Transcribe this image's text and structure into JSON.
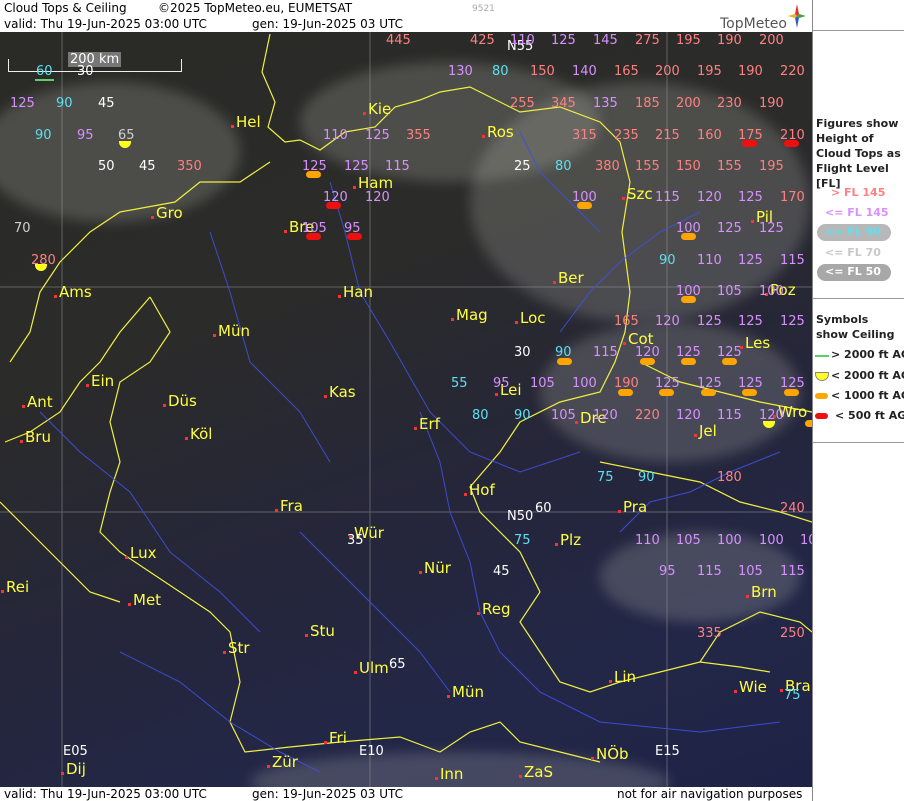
{
  "header": {
    "title": "Cloud Tops & Ceiling",
    "copyright": "©2025 TopMeteo.eu, EUMETSAT",
    "valid": "valid:  Thu  19-Jun-2025  03:00 UTC",
    "gen": "gen: 19-Jun-2025 03 UTC",
    "code": "9521",
    "logo": "TopMeteo",
    "logo_icon": "compass-star-icon"
  },
  "footer": {
    "valid": "valid:  Thu  19-Jun-2025  03:00 UTC",
    "gen": "gen: 19-Jun-2025 03 UTC",
    "disclaimer": "not for air navigation purposes"
  },
  "scale": {
    "label": "200 km"
  },
  "grid_labels": [
    "N55",
    "N50",
    "E05",
    "E10",
    "E15"
  ],
  "cities": [
    "Kie",
    "Hel",
    "Ros",
    "Ham",
    "Gro",
    "Bre",
    "Ber",
    "Szc",
    "Pil",
    "Ams",
    "Han",
    "Mag",
    "Loc",
    "Poz",
    "Mün",
    "Cot",
    "Les",
    "Ein",
    "Ant",
    "Düs",
    "Kas",
    "Lei",
    "Köl",
    "Erf",
    "Dre",
    "Bru",
    "Wro",
    "Jel",
    "Hof",
    "Fra",
    "Pra",
    "Würz",
    "Lux",
    "Plz",
    "Nür",
    "Rei",
    "Met",
    "Reg",
    "Brn",
    "Stu",
    "Str",
    "Ulm",
    "Lin",
    "Mün",
    "Wie",
    "Bra",
    "Fri",
    "Zür",
    "Inn",
    "ZaS",
    "NÖb",
    "Dij"
  ],
  "city_labels": {
    "c0": "Kie",
    "c1": "Hel",
    "c2": "Ros",
    "c3": "Ham",
    "c4": "Gro",
    "c5": "Bre",
    "c6": "Ber",
    "c7": "Szc",
    "c8": "Pil",
    "c9": "Ams",
    "c10": "Han",
    "c11": "Mag",
    "c12": "Loc",
    "c13": "Poz",
    "c14": "Mün",
    "c15": "Cot",
    "c16": "Les",
    "c17": "Ein",
    "c18": "Ant",
    "c19": "Düs",
    "c20": "Kas",
    "c21": "Lei",
    "c22": "Köl",
    "c23": "Erf",
    "c24": "Dre",
    "c25": "Bru",
    "c26": "Wro",
    "c27": "Jel",
    "c28": "Hof",
    "c29": "Fra",
    "c30": "Pra",
    "c31": "Wür",
    "c32": "Lux",
    "c33": "Plz",
    "c34": "Nür",
    "c35": "Rei",
    "c36": "Met",
    "c37": "Reg",
    "c38": "Brn",
    "c39": "Stu",
    "c40": "Str",
    "c41": "Ulm",
    "c42": "Lin",
    "c43": "Mün",
    "c44": "Wie",
    "c45": "Bra",
    "c46": "Fri",
    "c47": "Zür",
    "c48": "Inn",
    "c49": "ZaS",
    "c50": "NÖb",
    "c51": "Dij"
  },
  "flight_levels": {
    "f0": "445",
    "f1": "425",
    "f2": "110",
    "f3": "125",
    "f4": "145",
    "f5": "275",
    "f6": "195",
    "f7": "190",
    "f8": "200",
    "f9": "60",
    "f10": "30",
    "f11": "130",
    "f12": "80",
    "f13": "150",
    "f14": "140",
    "f15": "165",
    "f16": "200",
    "f17": "195",
    "f18": "190",
    "f19": "220",
    "f20": "125",
    "f21": "90",
    "f22": "45",
    "f23": "255",
    "f24": "345",
    "f25": "135",
    "f26": "185",
    "f27": "200",
    "f28": "230",
    "f29": "190",
    "f30": "90",
    "f31": "95",
    "f32": "65",
    "f33": "110",
    "f34": "125",
    "f35": "355",
    "f36": "315",
    "f37": "235",
    "f38": "215",
    "f39": "160",
    "f40": "175",
    "f41": "210",
    "f42": "50",
    "f43": "45",
    "f44": "350",
    "f45": "125",
    "f46": "125",
    "f47": "115",
    "f48": "25",
    "f49": "80",
    "f50": "380",
    "f51": "155",
    "f52": "150",
    "f53": "155",
    "f54": "195",
    "f55": "120",
    "f56": "120",
    "f57": "100",
    "f58": "115",
    "f59": "120",
    "f60": "125",
    "f61": "170",
    "f62": "70",
    "f63": "105",
    "f64": "95",
    "f65": "100",
    "f66": "125",
    "f67": "125",
    "f68": "280",
    "f69": "90",
    "f70": "110",
    "f71": "125",
    "f72": "115",
    "f73": "100",
    "f74": "105",
    "f75": "100",
    "f76": "165",
    "f77": "120",
    "f78": "125",
    "f79": "125",
    "f80": "125",
    "f81": "30",
    "f82": "90",
    "f83": "115",
    "f84": "120",
    "f85": "125",
    "f86": "125",
    "f87": "55",
    "f88": "95",
    "f89": "105",
    "f90": "100",
    "f91": "190",
    "f92": "125",
    "f93": "125",
    "f94": "125",
    "f95": "125",
    "f96": "80",
    "f97": "90",
    "f98": "105",
    "f99": "120",
    "f100": "220",
    "f101": "120",
    "f102": "115",
    "f103": "120",
    "f104": "75",
    "f105": "90",
    "f106": "180",
    "f107": "60",
    "f108": "240",
    "f109": "35",
    "f110": "75",
    "f111": "110",
    "f112": "105",
    "f113": "100",
    "f114": "100",
    "f115": "105",
    "f116": "45",
    "f117": "95",
    "f118": "115",
    "f119": "105",
    "f120": "115",
    "f121": "335",
    "f122": "250",
    "f123": "65",
    "f124": "75"
  },
  "legend": {
    "title": "Figures show Height of Cloud Tops as Flight Level  [FL]",
    "fl_items": [
      "> FL 145",
      "<= FL 145",
      "<= FL 90",
      "<= FL 70",
      "<= FL 50"
    ],
    "sym_title": "Symbols show Ceiling",
    "sym_items": [
      "> 2000 ft AGL",
      "< 2000 ft AGL",
      "< 1000 ft AGL",
      "< 500 ft AGL"
    ],
    "colors": {
      "high": "#ff8080",
      "mid": "#d890ff",
      "low90": "#5ee0f0",
      "low70": "#d0d0d0",
      "low50": "#ffffff",
      "green": "#5ccf6a",
      "yellow": "#ffff20",
      "orange": "#ffa500",
      "red": "#ee1010"
    }
  }
}
